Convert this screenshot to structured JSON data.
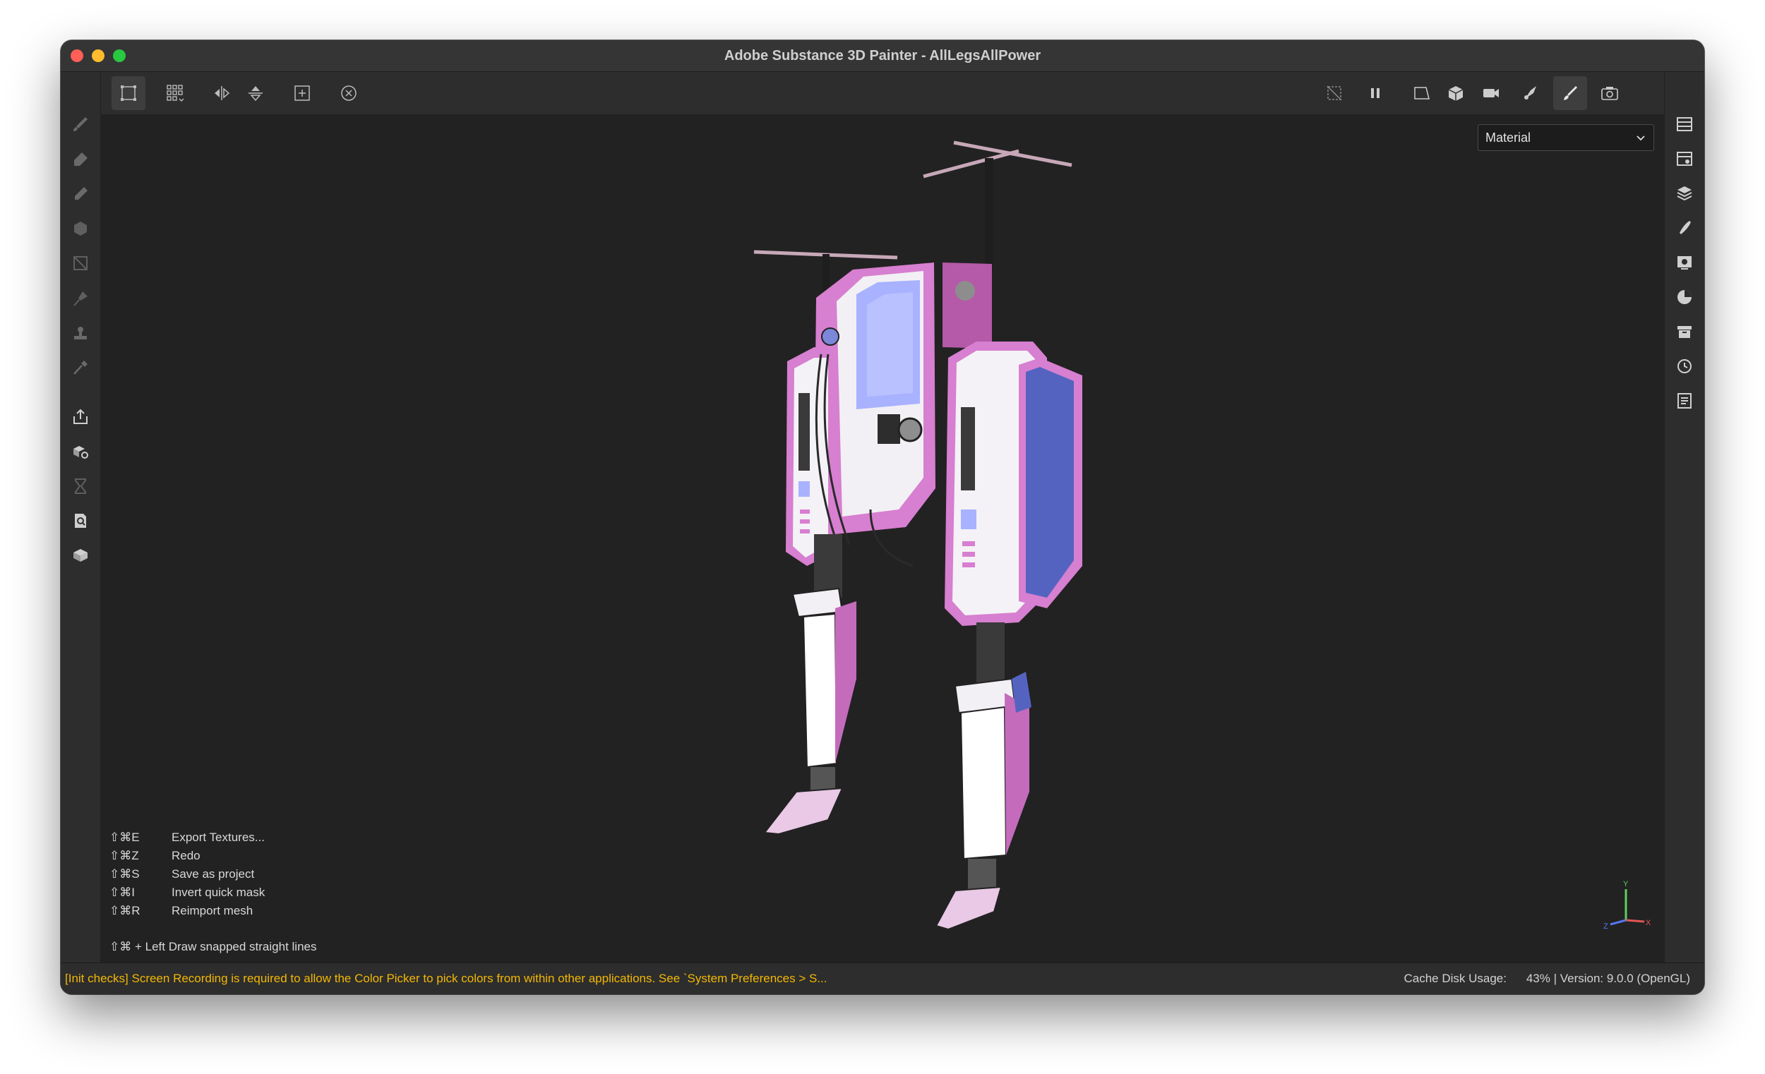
{
  "window": {
    "title": "Adobe Substance 3D Painter - AllLegsAllPower"
  },
  "toolbar": {
    "left": [
      {
        "icon": "selection-mode-icon"
      },
      {
        "icon": "grid-snap-icon"
      },
      {
        "icon": "symmetry-x-icon"
      },
      {
        "icon": "symmetry-y-icon"
      },
      {
        "icon": "fit-viewport-icon"
      },
      {
        "icon": "reset-camera-icon"
      }
    ],
    "right": [
      {
        "icon": "hide-geometry-icon"
      },
      {
        "icon": "pause-icon"
      },
      {
        "icon": "view-2d-icon"
      },
      {
        "icon": "view-3d-icon"
      },
      {
        "icon": "camera-icon"
      },
      {
        "icon": "symmetry-brush-icon"
      },
      {
        "icon": "paint-brush-icon"
      },
      {
        "icon": "screenshot-icon"
      }
    ]
  },
  "left_tools": [
    "paint-brush-icon",
    "eraser-icon",
    "projection-icon",
    "polygon-fill-icon",
    "uv-fill-icon",
    "smudge-icon",
    "clone-stamp-icon",
    "color-picker-icon",
    "export-icon",
    "bake-icon",
    "hourglass-icon",
    "document-search-icon",
    "material-box-icon"
  ],
  "right_panels": [
    "texture-set-list-icon",
    "texture-set-settings-icon",
    "layers-icon",
    "properties-icon",
    "display-settings-icon",
    "shader-settings-icon",
    "assets-icon",
    "history-icon",
    "log-icon"
  ],
  "viewport": {
    "display_mode": "Material",
    "shortcuts": [
      {
        "key": "⇧⌘E",
        "label": "Export Textures..."
      },
      {
        "key": "⇧⌘Z",
        "label": "Redo"
      },
      {
        "key": "⇧⌘S",
        "label": "Save as project"
      },
      {
        "key": "⇧⌘I",
        "label": "Invert quick mask"
      },
      {
        "key": "⇧⌘R",
        "label": "Reimport mesh"
      }
    ],
    "hint": "⇧⌘ + Left  Draw snapped straight lines",
    "axis": {
      "x": "X",
      "y": "Y",
      "z": "Z"
    }
  },
  "status": {
    "message": "[Init checks] Screen Recording is required to allow the Color Picker to pick colors from within other applications. See `System Preferences > S...",
    "cache_label": "Cache Disk Usage:",
    "version": "43% | Version: 9.0.0 (OpenGL)"
  },
  "colors": {
    "accent_pink": "#c86fc0",
    "panel_blue": "#a9b2ff",
    "warning": "#f2b705"
  }
}
